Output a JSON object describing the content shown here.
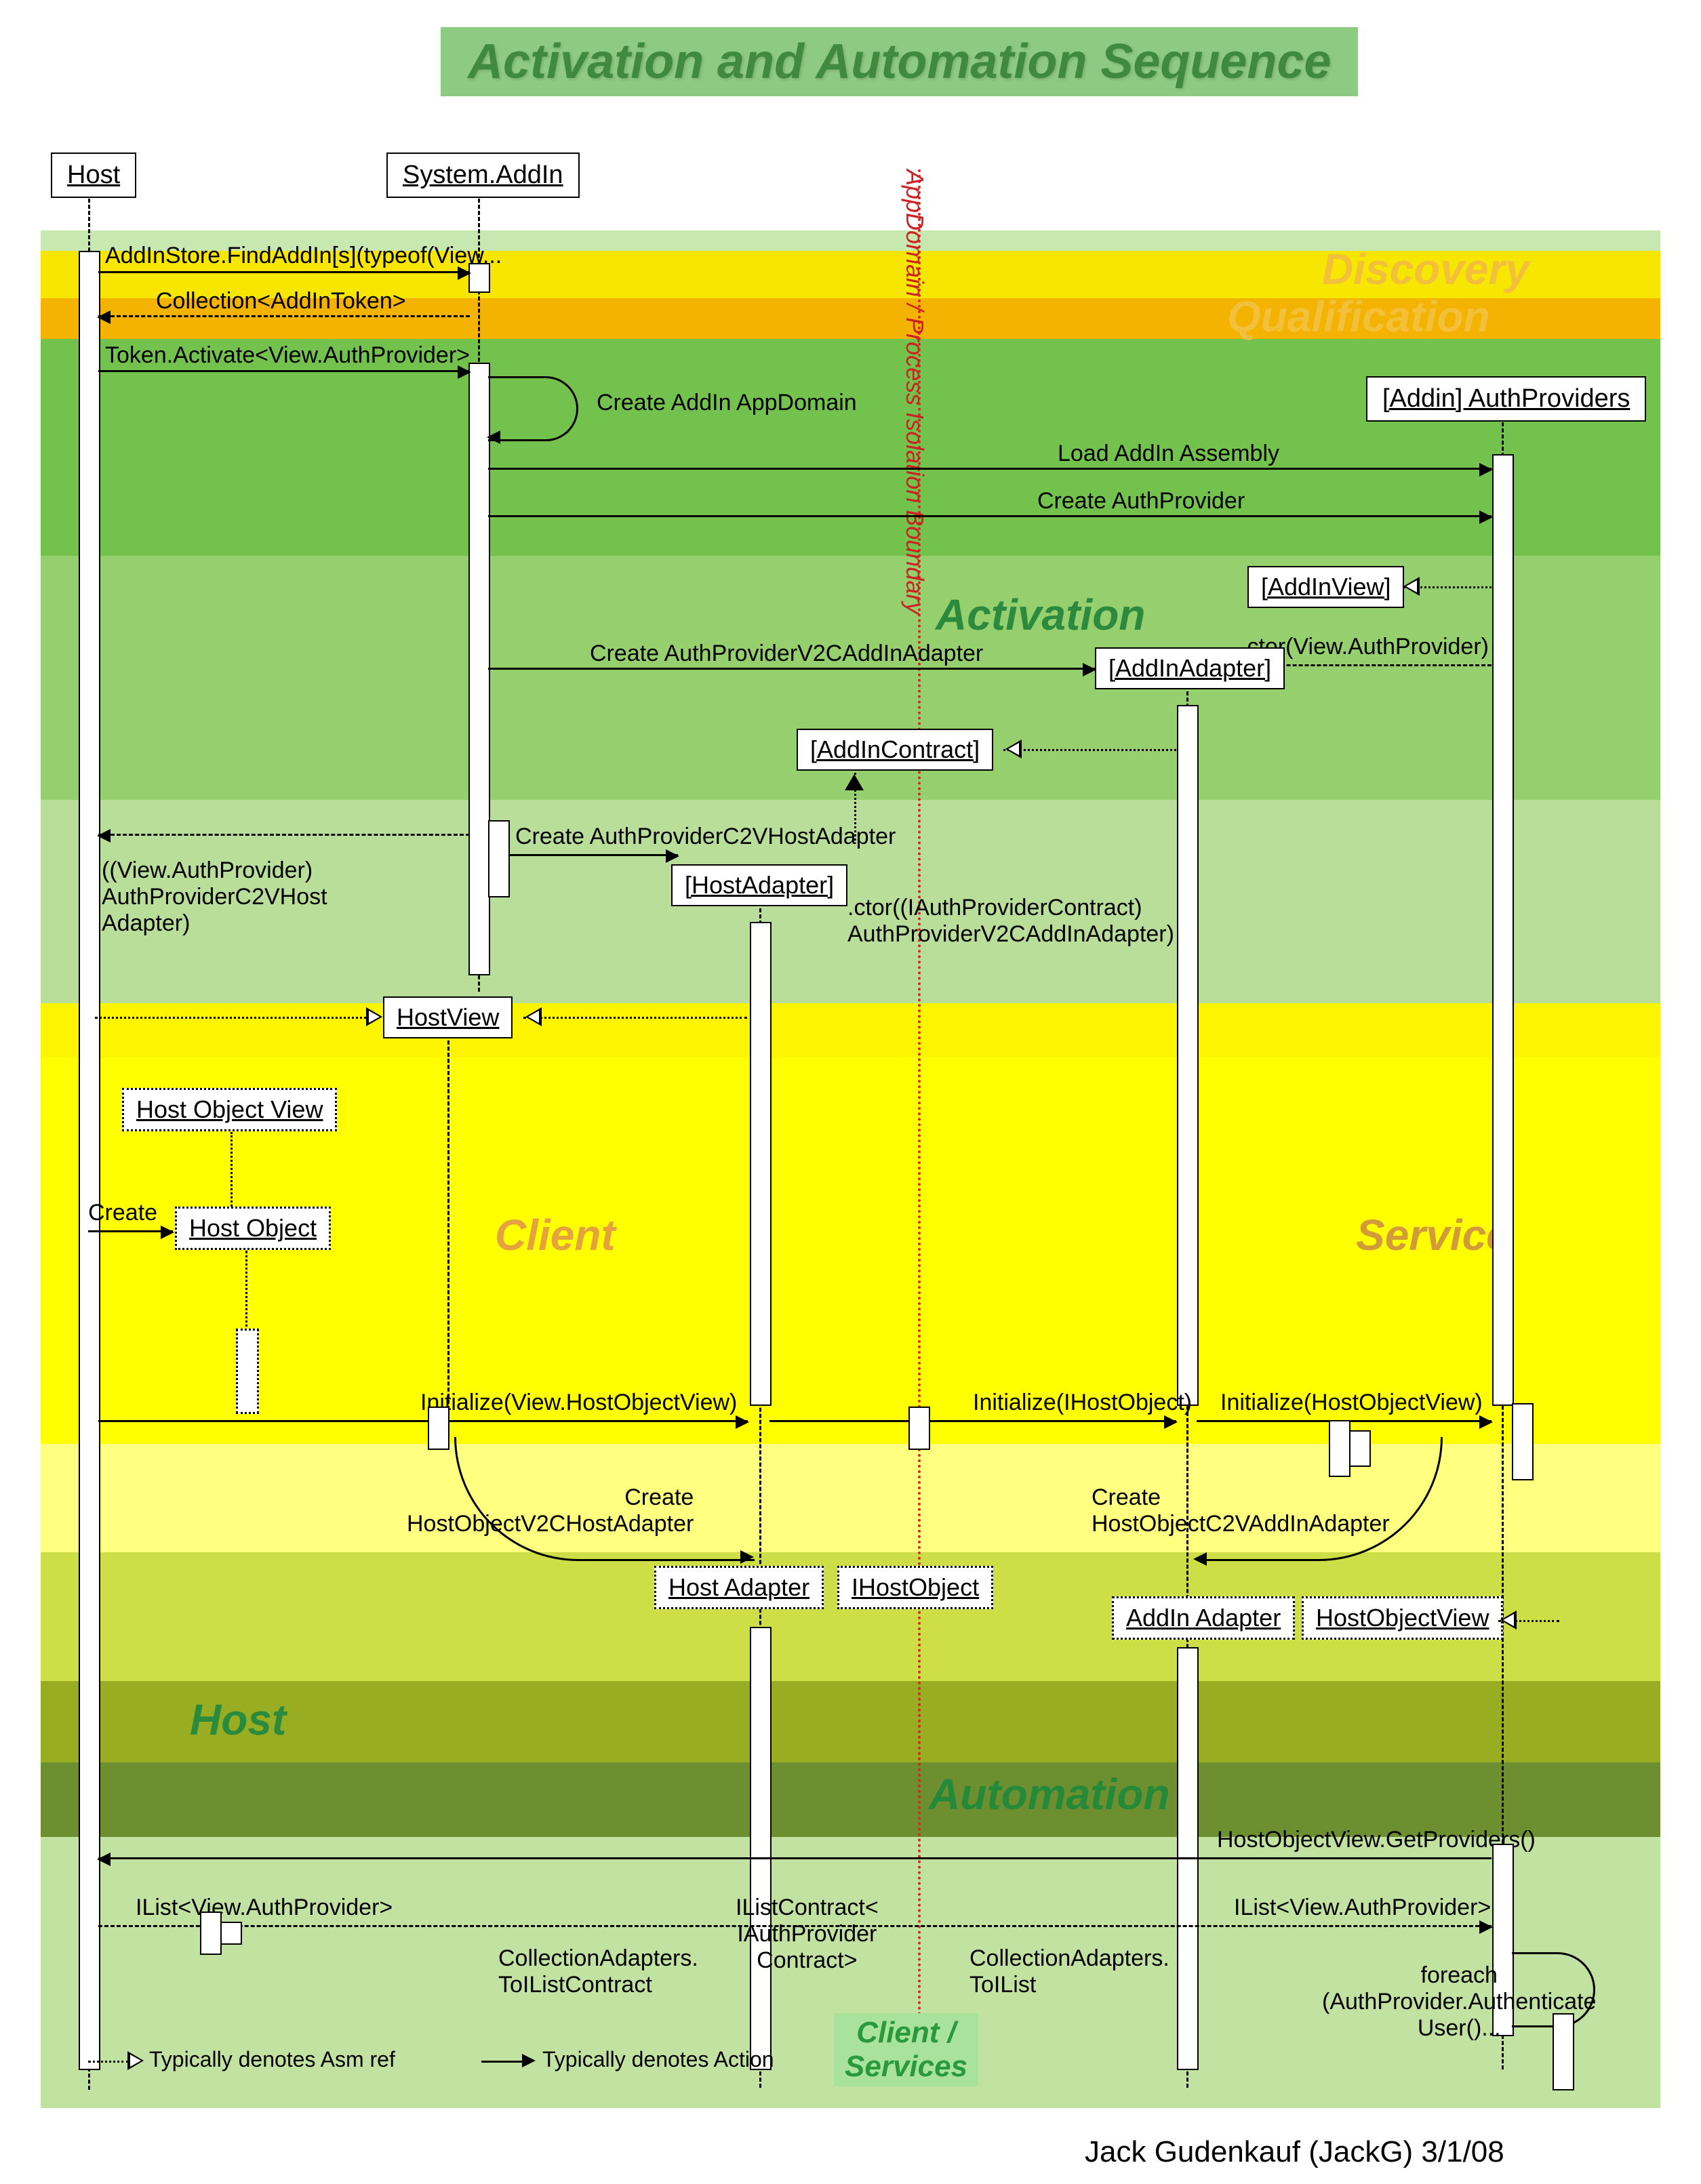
{
  "title": "Activation and Automation Sequence",
  "credit": "Jack Gudenkauf (JackG) 3/1/08",
  "boundary_label": "AppDomain / Process Isolation Boundary",
  "lifelines": {
    "host": "Host",
    "system_addin": "System.AddIn",
    "auth_providers": "[Addin] AuthProviders"
  },
  "phases": {
    "discovery": "Discovery",
    "qualification": "Qualification",
    "activation": "Activation",
    "client": "Client",
    "service": "Service",
    "host": "Host",
    "automation": "Automation",
    "client_services": "Client /\nServices"
  },
  "objects": {
    "addin_view": "[AddInView]",
    "addin_adapter": "[AddInAdapter]",
    "addin_contract": "[AddInContract]",
    "host_adapter": "[HostAdapter]",
    "host_view": "HostView",
    "host_object_view": "Host Object View",
    "host_object": "Host Object",
    "host_adapter2": "Host Adapter",
    "ihost_object": "IHostObject",
    "addin_adapter2": "AddIn Adapter",
    "host_object_view2": "HostObjectView"
  },
  "messages": {
    "find_addins": "AddInStore.FindAddIn[s](typeof(View...",
    "collection_token": "Collection<AddInToken>",
    "token_activate": "Token.Activate<View.AuthProvider>",
    "create_appdomain": "Create AddIn AppDomain",
    "load_assembly": "Load AddIn Assembly",
    "create_authprovider": "Create AuthProvider",
    "ctor_view_auth": ".ctor(View.AuthProvider)",
    "create_v2c_addin": "Create AuthProviderV2CAddInAdapter",
    "create_c2v_host": "Create AuthProviderC2VHostAdapter",
    "ctor_iauth": ".ctor((IAuthProviderContract)\nAuthProviderV2CAddInAdapter)",
    "view_authprovider_c2v": "((View.AuthProvider)\nAuthProviderC2VHost\nAdapter)",
    "create_label": "Create",
    "init_view_hov": "Initialize(View.HostObjectView)",
    "init_ihost": "Initialize(IHostObject)",
    "init_hov": "Initialize(HostObjectView)",
    "create_hov2c": "Create\nHostObjectV2CHostAdapter",
    "create_hoc2v": "Create\nHostObjectC2VAddInAdapter",
    "hov_getproviders": "HostObjectView.GetProviders()",
    "ilist_view_auth": "IList<View.AuthProvider>",
    "ilistcontract": "IListContract<\nIAuthProvider\nContract>",
    "coll_toilist_contract": "CollectionAdapters.\nToIListContract",
    "coll_toilist": "CollectionAdapters.\nToIList",
    "foreach_auth": "foreach\n(AuthProvider.Authenticate\nUser()..."
  },
  "legend": {
    "asm_ref": "Typically denotes Asm ref",
    "action": "Typically denotes Action"
  }
}
